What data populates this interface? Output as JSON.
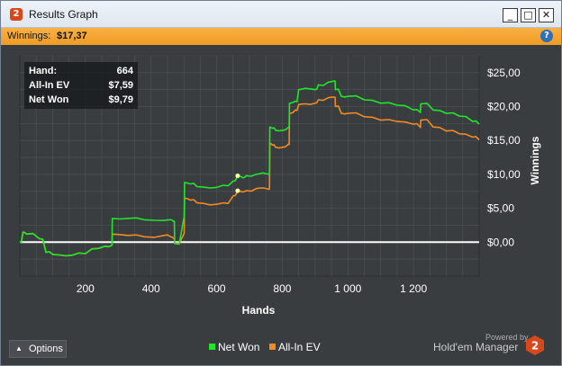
{
  "window": {
    "title": "Results Graph",
    "controls": {
      "minimize": "_",
      "maximize": "□",
      "close": "✕"
    }
  },
  "winnings_bar": {
    "label": "Winnings:",
    "value": "$17,37",
    "help_icon": "?"
  },
  "stats": [
    {
      "label": "Hand:",
      "value": "664"
    },
    {
      "label": "All-In EV",
      "value": "$7,59"
    },
    {
      "label": "Net Won",
      "value": "$9,79"
    }
  ],
  "options_button": {
    "label": "Options"
  },
  "legend": [
    {
      "label": "Net Won",
      "color": "#22e52a"
    },
    {
      "label": "All-In EV",
      "color": "#f08a24"
    }
  ],
  "brand": {
    "powered_by": "Powered by",
    "name": "Hold'em Manager",
    "logo_text": "2"
  },
  "colors": {
    "plot_bg": "#3a3d40",
    "grid": "#4f5357",
    "zero_line": "#ffffff",
    "accent_orange": "#f5a332",
    "brand_red": "#d9481c"
  },
  "chart_data": {
    "type": "line",
    "xlabel": "Hands",
    "ylabel": "Winnings",
    "xlim": [
      0,
      1400
    ],
    "ylim": [
      -5,
      27.5
    ],
    "xticks": [
      200,
      400,
      600,
      800,
      1000,
      1200
    ],
    "xtick_labels": [
      "200",
      "400",
      "600",
      "800",
      "1 000",
      "1 200"
    ],
    "yticks": [
      0,
      5,
      10,
      15,
      20,
      25
    ],
    "ytick_labels": [
      "$0,00",
      "$5,00",
      "$10,00",
      "$15,00",
      "$20,00",
      "$25,00"
    ],
    "grid": true,
    "marker": {
      "x": 664,
      "net": 9.79,
      "ev": 7.59
    },
    "series": [
      {
        "name": "Net Won",
        "color": "#22e52a",
        "x": [
          0,
          10,
          20,
          60,
          80,
          100,
          140,
          180,
          220,
          260,
          280,
          282,
          330,
          380,
          440,
          460,
          470,
          472,
          500,
          502,
          520,
          540,
          580,
          620,
          650,
          664,
          680,
          690,
          720,
          740,
          760,
          762,
          770,
          780,
          800,
          820,
          822,
          840,
          850,
          870,
          900,
          910,
          940,
          960,
          962,
          980,
          1000,
          1050,
          1100,
          1150,
          1200,
          1220,
          1222,
          1260,
          1300,
          1340,
          1380,
          1400
        ],
        "y": [
          0,
          1.5,
          1.2,
          0.5,
          -1.5,
          -1.8,
          -2.0,
          -1.6,
          -1.0,
          -0.6,
          -0.5,
          3.5,
          3.5,
          3.3,
          3.2,
          3.3,
          3.0,
          -0.2,
          3.5,
          8.8,
          8.6,
          8.2,
          8.0,
          8.4,
          9.0,
          9.79,
          9.5,
          9.8,
          10.0,
          10.2,
          10.0,
          17.0,
          16.8,
          16.5,
          16.5,
          17.0,
          20.5,
          20.8,
          22.5,
          22.7,
          22.5,
          23.2,
          23.6,
          23.8,
          22.5,
          21.5,
          21.5,
          21.0,
          20.5,
          20.2,
          19.5,
          19.2,
          20.4,
          19.5,
          19.0,
          18.6,
          17.8,
          17.4
        ]
      },
      {
        "name": "All-In EV",
        "color": "#f08a24",
        "x": [
          0,
          10,
          20,
          60,
          80,
          100,
          140,
          180,
          220,
          260,
          280,
          282,
          330,
          380,
          440,
          460,
          470,
          472,
          500,
          502,
          520,
          540,
          580,
          620,
          650,
          664,
          680,
          690,
          720,
          740,
          760,
          762,
          770,
          780,
          800,
          820,
          822,
          840,
          850,
          870,
          900,
          910,
          940,
          960,
          962,
          980,
          1000,
          1050,
          1100,
          1150,
          1200,
          1220,
          1222,
          1260,
          1300,
          1340,
          1380,
          1400
        ],
        "y": [
          0,
          1.5,
          1.2,
          0.5,
          -1.5,
          -1.8,
          -2.0,
          -1.6,
          -1.0,
          -0.6,
          -0.5,
          1.2,
          1.0,
          0.8,
          1.0,
          0.8,
          0.5,
          -0.1,
          1.2,
          6.5,
          6.2,
          5.8,
          5.5,
          5.8,
          6.8,
          7.59,
          7.4,
          7.6,
          7.9,
          8.0,
          7.8,
          14.6,
          14.3,
          14.0,
          14.0,
          14.5,
          19.0,
          19.5,
          20.3,
          20.4,
          20.5,
          21.0,
          21.3,
          21.4,
          20.0,
          19.0,
          19.0,
          18.5,
          18.0,
          17.8,
          17.4,
          17.0,
          18.0,
          17.0,
          16.4,
          16.0,
          15.5,
          15.1
        ]
      }
    ]
  }
}
